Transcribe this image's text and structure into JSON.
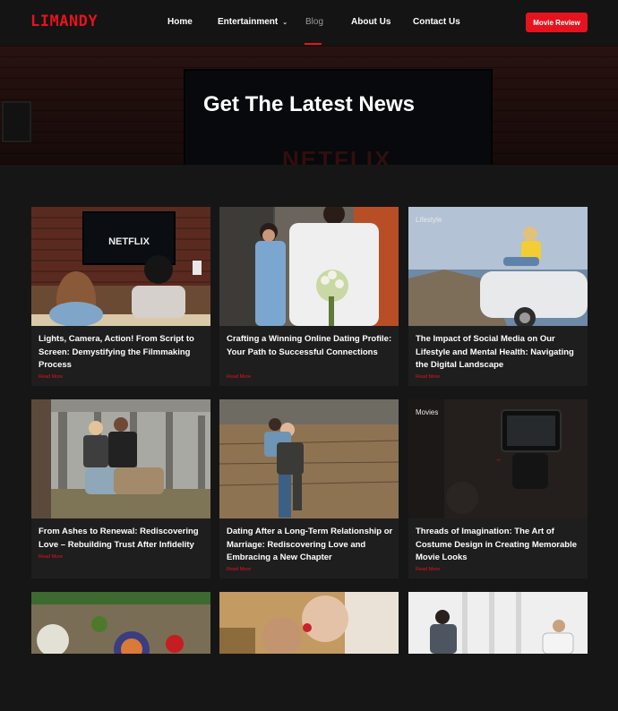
{
  "header": {
    "logo": "LIMANDY",
    "nav": [
      {
        "label": "Home",
        "active": false
      },
      {
        "label": "Entertainment",
        "active": false,
        "has_dropdown": true
      },
      {
        "label": "Blog",
        "active": true
      },
      {
        "label": "About Us",
        "active": false
      },
      {
        "label": "Contact Us",
        "active": false
      }
    ],
    "cta": "Movie Review",
    "icons": {
      "dropdown": "chevron-down-icon"
    }
  },
  "hero": {
    "title": "Get The Latest News",
    "tv_text": "NETFLIX"
  },
  "posts": [
    {
      "title": "Lights, Camera, Action! From Script to Screen: Demystifying the Filmmaking Process",
      "read_more": "Read More",
      "category": "",
      "image": "friends-watching-netflix"
    },
    {
      "title": "Crafting a Winning Online Dating Profile: Your Path to Successful Connections",
      "read_more": "Read More",
      "category": "",
      "image": "couple-with-flowers"
    },
    {
      "title": "The Impact of Social Media on Our Lifestyle and Mental Health: Navigating the Digital Landscape",
      "read_more": "Read More",
      "category": "Lifestyle",
      "image": "woman-on-car-with-phone"
    },
    {
      "title": "From Ashes to Renewal: Rediscovering Love – Rebuilding Trust After Infidelity",
      "read_more": "Read More",
      "category": "",
      "image": "couple-sitting-by-bridge"
    },
    {
      "title": "Dating After a Long-Term Relationship or Marriage: Rediscovering Love and Embracing a New Chapter",
      "read_more": "Read More",
      "category": "",
      "image": "couple-piggyback-field"
    },
    {
      "title": "Threads of Imagination: The Art of Costume Design in Creating Memorable Movie Looks",
      "read_more": "Read More",
      "category": "Movies",
      "image": "film-camera-on-set"
    },
    {
      "title": "",
      "read_more": "",
      "category": "",
      "image": "food-table-top-view"
    },
    {
      "title": "",
      "read_more": "",
      "category": "",
      "image": "couple-smelling-flower"
    },
    {
      "title": "",
      "read_more": "",
      "category": "",
      "image": "therapy-session-room"
    }
  ],
  "colors": {
    "accent": "#e5131d",
    "background": "#161616",
    "card": "#1e1e1e",
    "header": "#141414"
  }
}
